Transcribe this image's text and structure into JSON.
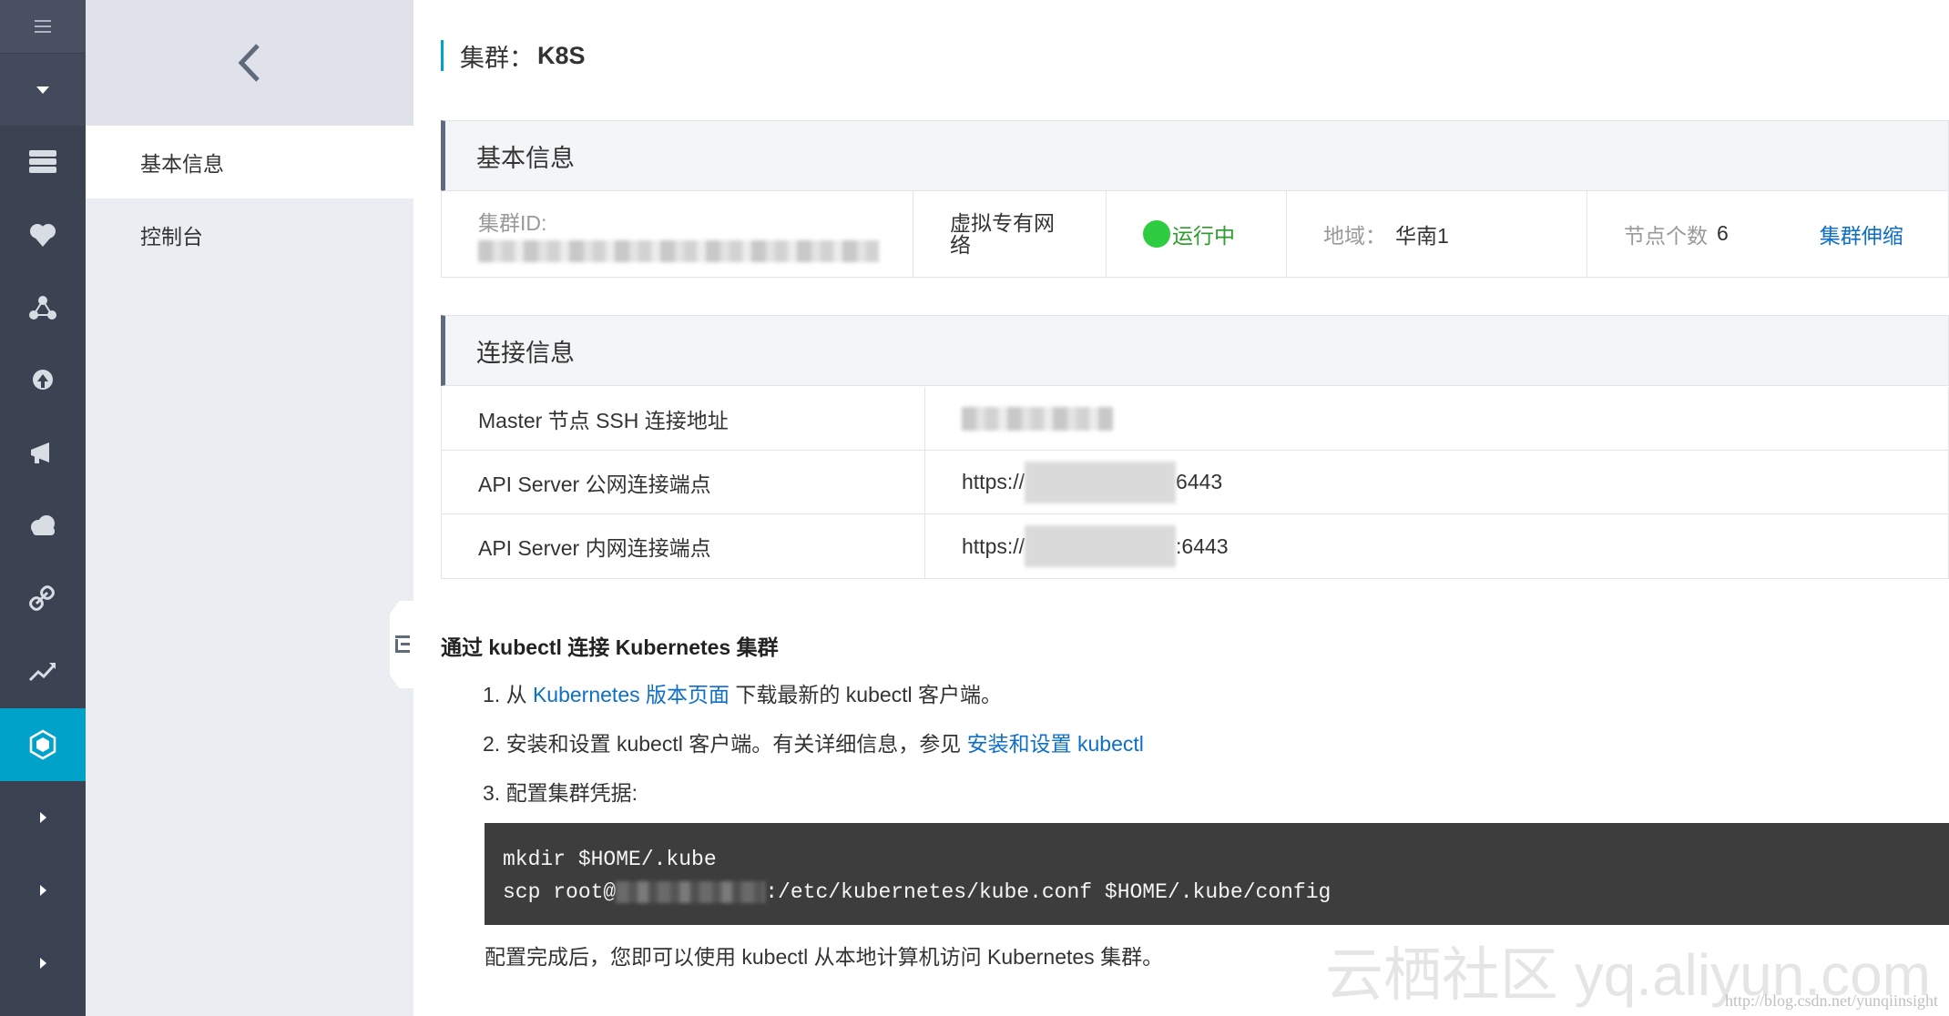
{
  "page": {
    "title_prefix": "集群：",
    "title_name": "K8S"
  },
  "sidebar": {
    "items": [
      {
        "label": "基本信息",
        "active": true
      },
      {
        "label": "控制台",
        "active": false
      }
    ]
  },
  "basic_info": {
    "header": "基本信息",
    "cluster_id_label": "集群ID:",
    "network_label": "虚拟专有网络",
    "status": "运行中",
    "status_color": "#2ecc40",
    "region_label": "地域：",
    "region_value": "华南1",
    "nodes_label": "节点个数",
    "nodes_value": "6",
    "scale_link": "集群伸缩"
  },
  "connection": {
    "header": "连接信息",
    "rows": [
      {
        "key": "Master 节点 SSH 连接地址",
        "prefix": "",
        "suffix": ""
      },
      {
        "key": "API Server 公网连接端点",
        "prefix": "https://",
        "suffix": "6443"
      },
      {
        "key": "API Server 内网连接端点",
        "prefix": "https://",
        "suffix": ":6443"
      }
    ]
  },
  "kubectl": {
    "title": "通过 kubectl 连接 Kubernetes 集群",
    "step1_pre": "1. 从 ",
    "step1_link": "Kubernetes 版本页面",
    "step1_post": " 下载最新的 kubectl 客户端。",
    "step2_pre": "2. 安装和设置 kubectl 客户端。有关详细信息，参见 ",
    "step2_link": "安装和设置 kubectl",
    "step3": "3. 配置集群凭据:",
    "code_line1": "mkdir $HOME/.kube",
    "code_line2_pre": "scp root@",
    "code_line2_post": ":/etc/kubernetes/kube.conf $HOME/.kube/config",
    "done": "配置完成后，您即可以使用 kubectl 从本地计算机访问 Kubernetes 集群。"
  },
  "watermark": {
    "text": "云栖社区 yq.aliyun.com",
    "url": "http://blog.csdn.net/yunqiinsight"
  },
  "colors": {
    "accent": "#00a2ca",
    "link": "#0e6fc7",
    "rail": "#3b4252"
  }
}
